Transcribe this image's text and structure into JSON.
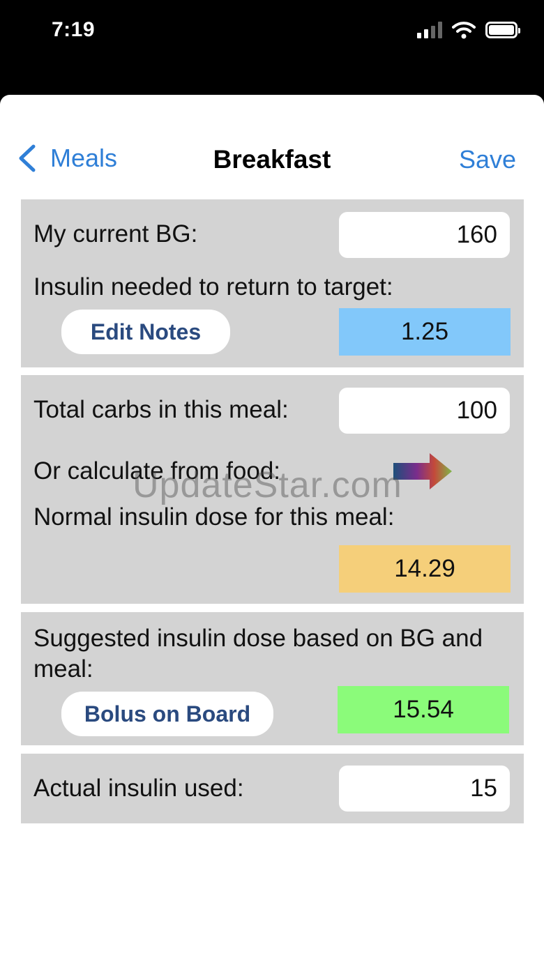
{
  "status": {
    "time": "7:19"
  },
  "nav": {
    "back_label": "Meals",
    "title": "Breakfast",
    "save_label": "Save"
  },
  "bg_section": {
    "bg_label": "My current BG:",
    "bg_value": "160",
    "insulin_target_label": "Insulin needed to return to target:",
    "edit_notes_label": "Edit Notes",
    "insulin_target_value": "1.25",
    "insulin_target_color": "#82c8fa"
  },
  "carb_section": {
    "carbs_label": "Total carbs in this meal:",
    "carbs_value": "100",
    "calc_food_label": "Or calculate from food:",
    "normal_dose_label": "Normal insulin dose for this meal:",
    "normal_dose_value": "14.29",
    "normal_dose_color": "#f5cf7a"
  },
  "suggest_section": {
    "suggest_label": "Suggested insulin dose based on BG and meal:",
    "bolus_label": "Bolus on Board",
    "suggest_value": "15.54",
    "suggest_color": "#8bfb7a"
  },
  "actual_section": {
    "actual_label": "Actual insulin used:",
    "actual_value": "15"
  },
  "watermark": "UpdateStar.com"
}
